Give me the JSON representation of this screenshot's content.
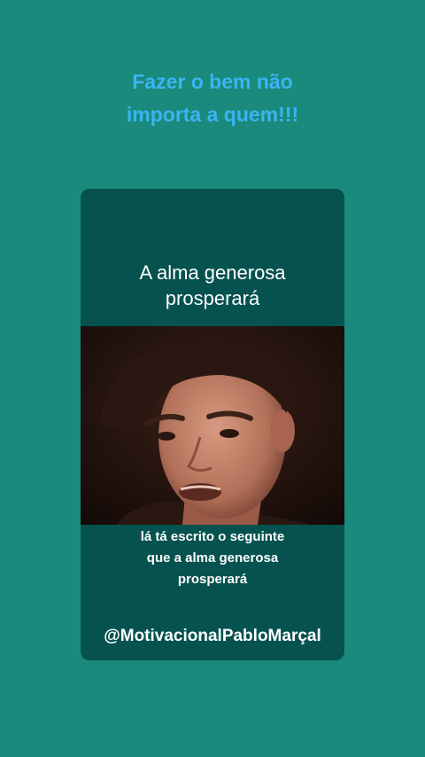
{
  "headline": {
    "line1": "Fazer o bem não",
    "line2": "importa a quem!!!"
  },
  "card": {
    "title_line1": "A alma generosa",
    "title_line2": "prosperará",
    "caption_line1": "lá tá escrito o seguinte",
    "caption_line2": "que a alma generosa",
    "caption_line3": "prosperará",
    "handle": "@MotivacionalPabloMarçal"
  },
  "colors": {
    "background": "#1a8a7c",
    "headline": "#3ab4f2",
    "card": "#06524f",
    "text": "#ffffff"
  }
}
